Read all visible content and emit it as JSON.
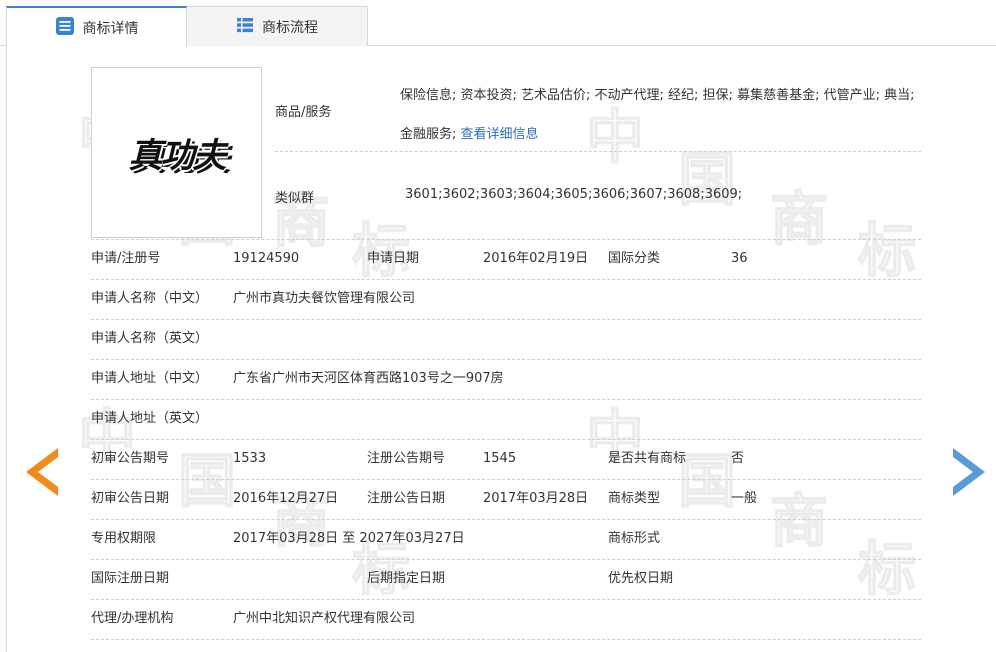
{
  "tabs": [
    {
      "label": "商标详情",
      "icon": "document-list-icon",
      "active": true
    },
    {
      "label": "商标流程",
      "icon": "list-icon",
      "active": false
    }
  ],
  "colors": {
    "accent": "#3c82d4",
    "link": "#2f6db5",
    "prev_arrow": "#f08a1c",
    "next_arrow": "#5b9bd5"
  },
  "watermark": [
    "中",
    "国",
    "商",
    "标"
  ],
  "trademark": {
    "logo_text": "真功夫"
  },
  "goods_services": {
    "label": "商品/服务",
    "value": "保险信息; 资本投资; 艺术品估价; 不动产代理; 经纪; 担保; 募集慈善基金; 代管产业; 典当; 金融服务;",
    "link": "查看详细信息"
  },
  "similar_group": {
    "label": "类似群",
    "value": "3601;3602;3603;3604;3605;3606;3607;3608;3609;"
  },
  "rows": [
    {
      "cells": [
        {
          "label": "申请/注册号",
          "value": "19124590"
        },
        {
          "label": "申请日期",
          "value": "2016年02月19日"
        },
        {
          "label": "国际分类",
          "value": "36"
        }
      ]
    },
    {
      "cells": [
        {
          "label": "申请人名称（中文）",
          "value": "广州市真功夫餐饮管理有限公司"
        }
      ]
    },
    {
      "cells": [
        {
          "label": "申请人名称（英文）",
          "value": ""
        }
      ]
    },
    {
      "cells": [
        {
          "label": "申请人地址（中文）",
          "value": "广东省广州市天河区体育西路103号之一907房"
        }
      ]
    },
    {
      "cells": [
        {
          "label": "申请人地址（英文）",
          "value": ""
        }
      ]
    },
    {
      "cells": [
        {
          "label": "初审公告期号",
          "value": "1533"
        },
        {
          "label": "注册公告期号",
          "value": "1545"
        },
        {
          "label": "是否共有商标",
          "value": "否"
        }
      ]
    },
    {
      "cells": [
        {
          "label": "初审公告日期",
          "value": "2016年12月27日"
        },
        {
          "label": "注册公告日期",
          "value": "2017年03月28日"
        },
        {
          "label": "商标类型",
          "value": "一般"
        }
      ]
    },
    {
      "cells": [
        {
          "label": "专用权期限",
          "value": "2017年03月28日 至 2027年03月27日"
        },
        {
          "label": "",
          "value": ""
        },
        {
          "label": "商标形式",
          "value": ""
        }
      ]
    },
    {
      "cells": [
        {
          "label": "国际注册日期",
          "value": ""
        },
        {
          "label": "后期指定日期",
          "value": ""
        },
        {
          "label": "优先权日期",
          "value": ""
        }
      ]
    },
    {
      "cells": [
        {
          "label": "代理/办理机构",
          "value": "广州中北知识产权代理有限公司"
        }
      ]
    }
  ]
}
